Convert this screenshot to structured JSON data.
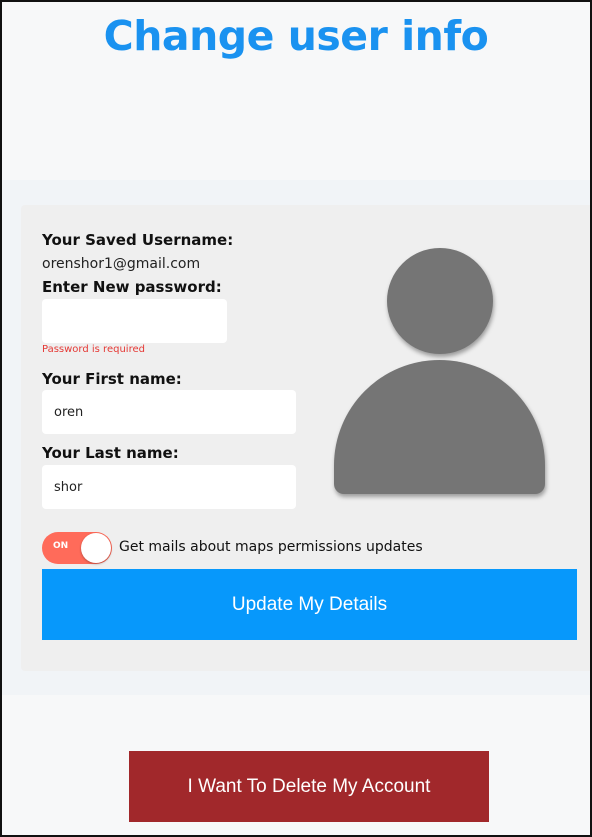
{
  "page": {
    "title": "Change user info"
  },
  "profile": {
    "saved_username_label": "Your Saved Username:",
    "saved_username_value": "orenshor1@gmail.com",
    "new_password_label": "Enter New password:",
    "new_password_value": "",
    "password_error": "Password is required",
    "first_name_label": "Your First name:",
    "first_name_value": "oren",
    "last_name_label": "Your Last name:",
    "last_name_value": "shor"
  },
  "mail_toggle": {
    "state_text": "ON",
    "is_on": true,
    "label": "Get mails about maps permissions updates"
  },
  "buttons": {
    "update": "Update My Details",
    "delete": "I Want To Delete My Account"
  },
  "colors": {
    "title": "#1a92f0",
    "update_button": "#0798fb",
    "delete_button": "#a1282b",
    "toggle_on": "#ff6b5a",
    "error": "#e53935",
    "avatar": "#757575"
  },
  "icons": {
    "avatar": "user-avatar-icon"
  }
}
